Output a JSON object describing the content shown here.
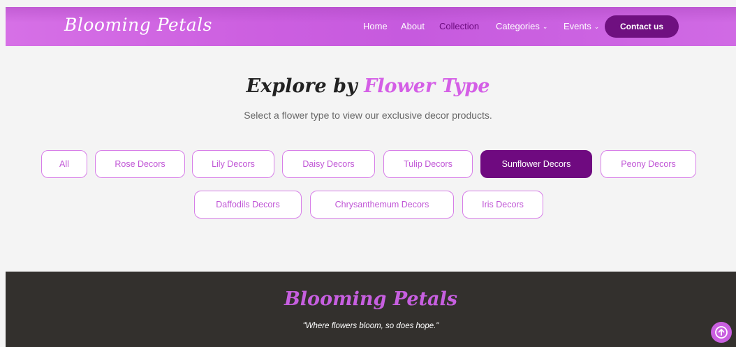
{
  "brand": "Blooming Petals",
  "nav": {
    "items": [
      {
        "label": "Home"
      },
      {
        "label": "About"
      },
      {
        "label": "Collection"
      },
      {
        "label": "Categories"
      },
      {
        "label": "Events"
      }
    ],
    "active": "Collection",
    "contact_label": "Contact us"
  },
  "section": {
    "heading_part1": "Explore by",
    "heading_part2": "Flower Type",
    "subtitle": "Select a flower type to view our exclusive decor products."
  },
  "filters": [
    {
      "label": "All"
    },
    {
      "label": "Rose Decors"
    },
    {
      "label": "Lily Decors"
    },
    {
      "label": "Daisy Decors"
    },
    {
      "label": "Tulip Decors"
    },
    {
      "label": "Sunflower Decors"
    },
    {
      "label": "Peony Decors"
    },
    {
      "label": "Daffodils Decors"
    },
    {
      "label": "Chrysanthemum Decors"
    },
    {
      "label": "Iris Decors"
    }
  ],
  "selected_filter": "Sunflower Decors",
  "footer": {
    "brand": "Blooming Petals",
    "tagline": "\"Where flowers bloom, so does hope.\""
  },
  "colors": {
    "navbar": "#cf66e3",
    "accent": "#d45ee6",
    "dark_purple": "#6f0a80",
    "footer_bg": "#33302d"
  },
  "icons": {
    "dropdown": "chevron-down-icon",
    "scroll_top": "arrow-up-circle-icon"
  }
}
